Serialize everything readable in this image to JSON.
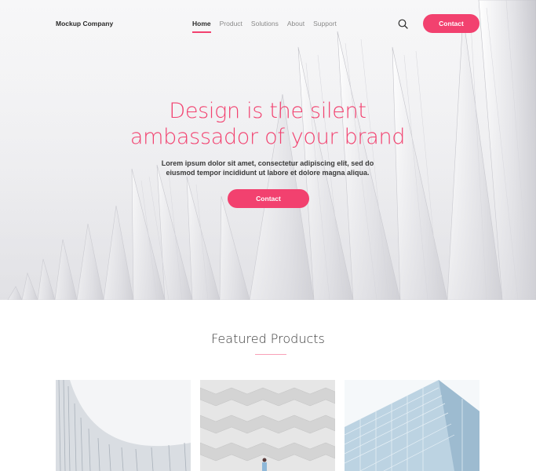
{
  "nav": {
    "brand": "Mockup Company",
    "items": [
      {
        "label": "Home",
        "active": true
      },
      {
        "label": "Product",
        "active": false
      },
      {
        "label": "Solutions",
        "active": false
      },
      {
        "label": "About",
        "active": false
      },
      {
        "label": "Support",
        "active": false
      }
    ],
    "search_icon": "search-icon",
    "contact_label": "Contact"
  },
  "hero": {
    "title_line1": "Design is the silent",
    "title_line2": "ambassador of your brand",
    "subtitle_line1": "Lorem ipsum dolor sit amet, consectetur adipiscing elit, sed do",
    "subtitle_line2": "eiusmod tempor incididunt ut labore et dolore magna aliqua.",
    "cta_label": "Contact"
  },
  "featured": {
    "title": "Featured Products"
  },
  "colors": {
    "accent": "#f2416f",
    "text_dark": "#2b2b2b",
    "text_muted": "#8a8a8a"
  }
}
